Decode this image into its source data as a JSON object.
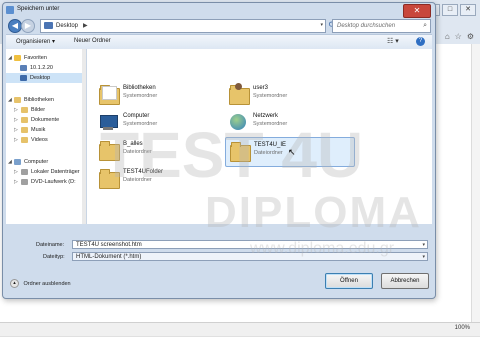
{
  "dialog": {
    "title": "Speichern unter",
    "close_glyph": "✕"
  },
  "navigation": {
    "back_glyph": "◀",
    "forward_glyph": "▶",
    "history_glyph": "▾",
    "address_crumb": "Desktop",
    "address_arrow": "▶",
    "address_dropdown": "▾",
    "refresh_glyph": "⟳",
    "search_placeholder": "Desktop durchsuchen",
    "search_glyph": "⌕"
  },
  "toolbar": {
    "organize_label": "Organisieren ▾",
    "new_folder_label": "Neuer Ordner",
    "view_glyph": "☷ ▾",
    "help_glyph": "?"
  },
  "nav_pane": {
    "items": [
      {
        "label": "Favoriten",
        "expander": "◢",
        "icon_color": "#f0c040"
      },
      {
        "label": "10.1.2.20",
        "expander": "",
        "icon_color": "#5a7fb6"
      },
      {
        "label": "Desktop",
        "expander": "",
        "icon_color": "#3d6aa9"
      },
      {
        "label": "Bibliotheken",
        "expander": "◢",
        "icon_color": "#e6c26a"
      },
      {
        "label": "Bilder",
        "expander": "▷",
        "icon_color": "#e6c26a"
      },
      {
        "label": "Dokumente",
        "expander": "▷",
        "icon_color": "#e6c26a"
      },
      {
        "label": "Musik",
        "expander": "▷",
        "icon_color": "#e6c26a"
      },
      {
        "label": "Videos",
        "expander": "▷",
        "icon_color": "#e6c26a"
      },
      {
        "label": "Computer",
        "expander": "◢",
        "icon_color": "#7aa0cc"
      },
      {
        "label": "Lokaler Datenträger",
        "expander": "▷",
        "icon_color": "#a0a0a0"
      },
      {
        "label": "DVD-Laufwerk (D:",
        "expander": "▷",
        "icon_color": "#a0a0a0"
      }
    ]
  },
  "files": [
    {
      "name": "Bibliotheken",
      "type": "Systemordner",
      "icon": "library-folder-icon"
    },
    {
      "name": "user3",
      "type": "Systemordner",
      "icon": "user-folder-icon"
    },
    {
      "name": "Computer",
      "type": "Systemordner",
      "icon": "computer-icon"
    },
    {
      "name": "Netzwerk",
      "type": "Systemordner",
      "icon": "network-icon"
    },
    {
      "name": "B_alles",
      "type": "Dateiordner",
      "icon": "folder-icon"
    },
    {
      "name": "TEST4U_IE",
      "type": "Dateiordner",
      "icon": "folder-icon"
    },
    {
      "name": "TEST4UFolder",
      "type": "Dateiordner",
      "icon": "folder-icon"
    }
  ],
  "form": {
    "filename_label": "Dateiname:",
    "filename_value": "TEST4U screenshot.htm",
    "filetype_label": "Dateityp:",
    "filetype_value": "HTML-Dokument (*.htm)",
    "dropdown_glyph": "▾"
  },
  "footer": {
    "hide_folders_label": "Ordner ausblenden",
    "hide_caret": "▴",
    "save_label": "Öffnen",
    "cancel_label": "Abbrechen"
  },
  "background": {
    "zoom_level": "100%",
    "minimize_glyph": "–",
    "maximize_glyph": "□",
    "close_glyph": "✕",
    "home_glyph": "⌂",
    "star_glyph": "☆",
    "gear_glyph": "⚙"
  },
  "watermark": {
    "brand": "DIPLOMA",
    "url": "www.diploma.edu.gr",
    "test_mark": "TEST 4U"
  },
  "colors": {
    "dialog_frame": "#cfdcec",
    "selection": "#cde3f7",
    "close_red": "#c8473c",
    "folder_yellow": "#e7c46a"
  }
}
